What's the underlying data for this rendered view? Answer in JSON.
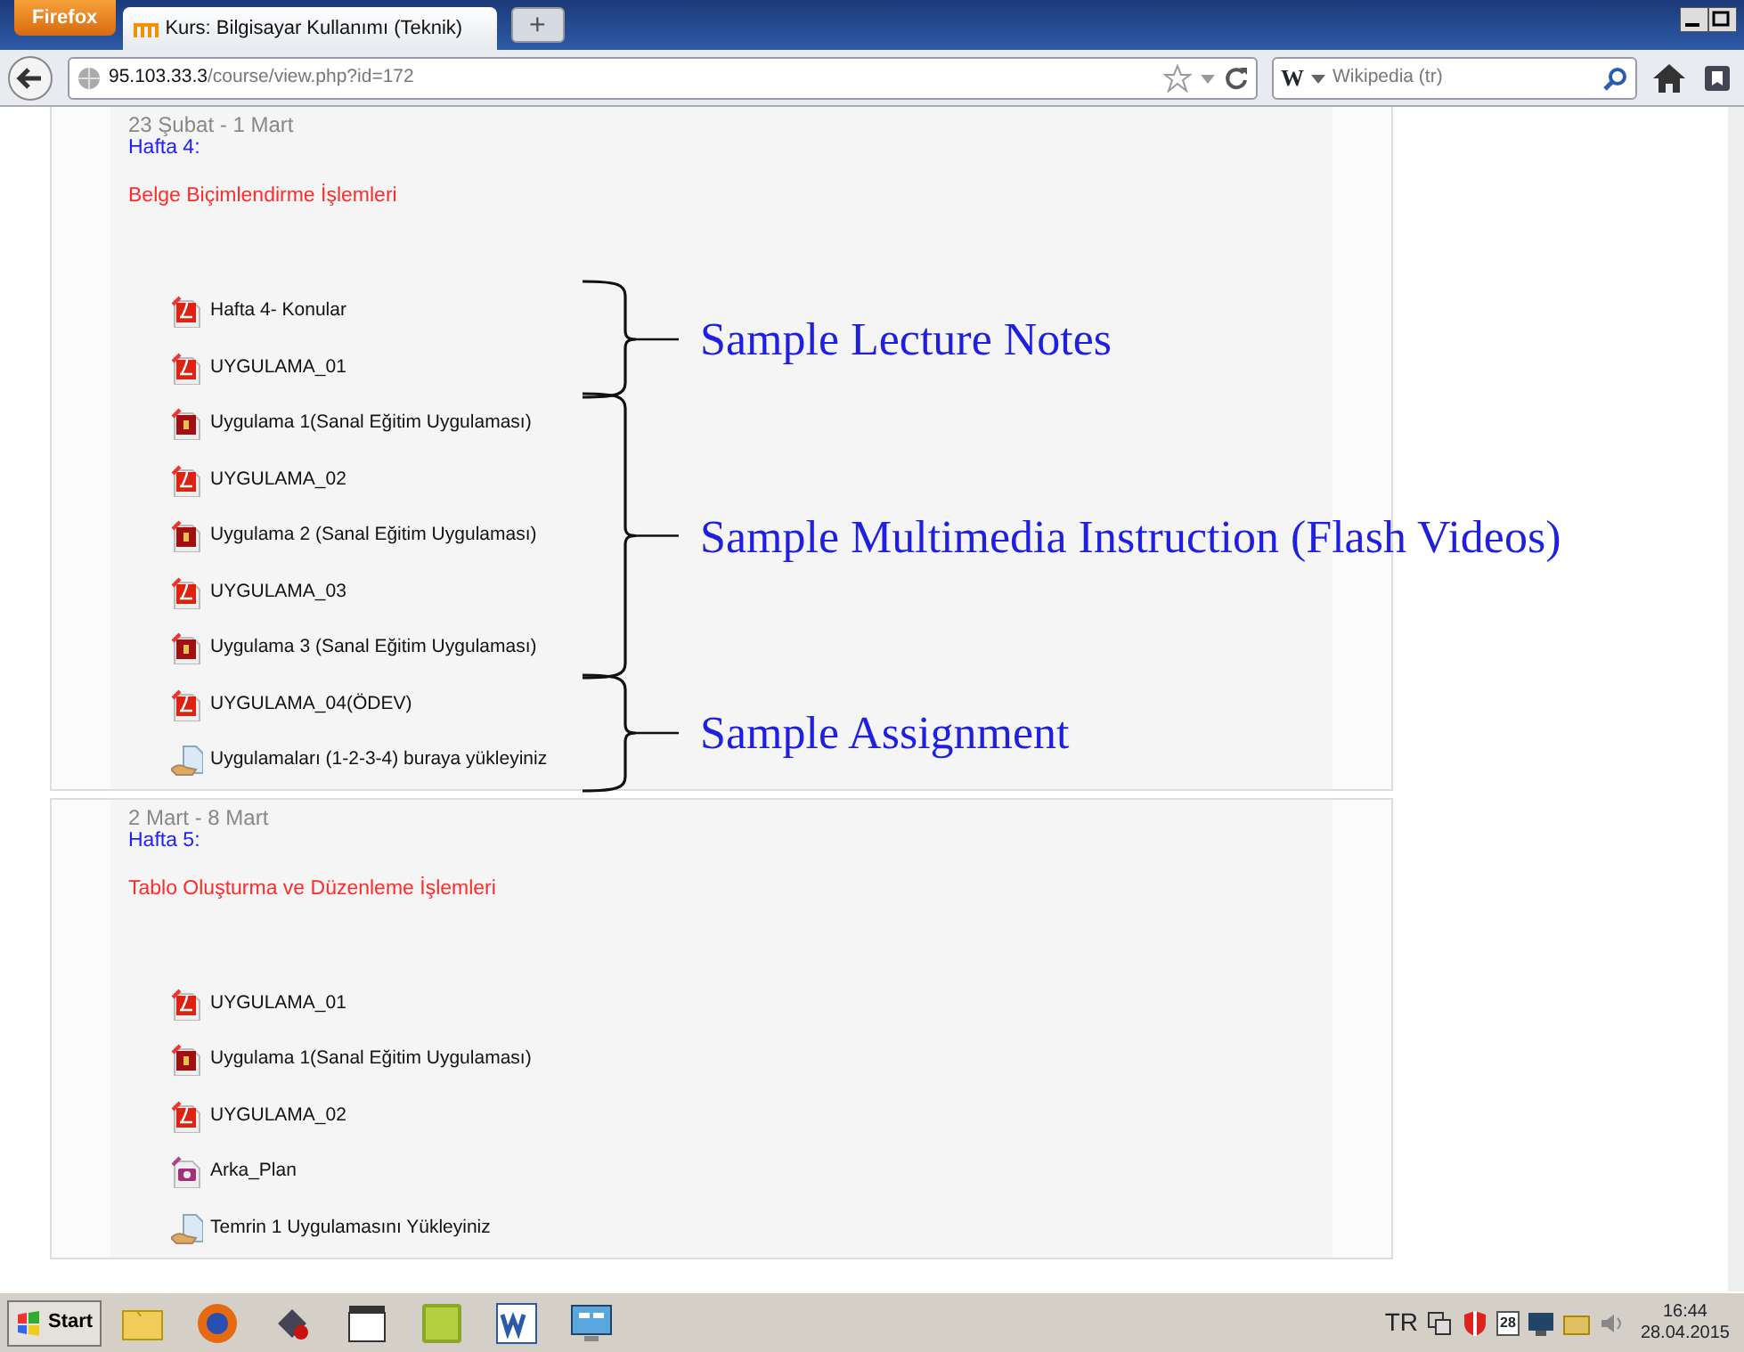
{
  "browser": {
    "menu_button": "Firefox",
    "tabs": [
      {
        "label": "Kurs: Bilgisayar Kullanımı (Teknik)",
        "selected": true
      }
    ],
    "new_tab": "+",
    "url_host": "95.103.33.3",
    "url_path": "/course/view.php?id=172",
    "search": {
      "engine": "W",
      "placeholder": "Wikipedia (tr)"
    }
  },
  "sections": [
    {
      "dates": "23 Şubat - 1 Mart",
      "week": "Hafta 4:",
      "topic": "Belge Biçimlendirme İşlemleri",
      "groups": [
        {
          "annotation": "Sample Lecture Notes",
          "items": [
            {
              "kind": "pdf",
              "label": "Hafta 4- Konular"
            },
            {
              "kind": "pdf",
              "label": "UYGULAMA_01"
            }
          ]
        },
        {
          "annotation": "Sample Multimedia Instruction (Flash Videos)",
          "items": [
            {
              "kind": "flash",
              "label": "Uygulama 1(Sanal Eğitim Uygulaması)"
            },
            {
              "kind": "pdf",
              "label": "UYGULAMA_02"
            },
            {
              "kind": "flash",
              "label": "Uygulama 2 (Sanal Eğitim Uygulaması)"
            },
            {
              "kind": "pdf",
              "label": "UYGULAMA_03"
            },
            {
              "kind": "flash",
              "label": "Uygulama 3 (Sanal Eğitim Uygulaması)"
            }
          ]
        },
        {
          "annotation": "Sample Assignment",
          "items": [
            {
              "kind": "pdf",
              "label": "UYGULAMA_04(ÖDEV)"
            },
            {
              "kind": "upload",
              "label": "Uygulamaları (1-2-3-4) buraya yükleyiniz"
            }
          ]
        }
      ]
    },
    {
      "dates": "2 Mart - 8 Mart",
      "week": "Hafta 5:",
      "topic": "Tablo Oluşturma ve Düzenleme İşlemleri",
      "items": [
        {
          "kind": "pdf",
          "label": "UYGULAMA_01"
        },
        {
          "kind": "flash",
          "label": "Uygulama 1(Sanal Eğitim Uygulaması)"
        },
        {
          "kind": "pdf",
          "label": "UYGULAMA_02"
        },
        {
          "kind": "image",
          "label": "Arka_Plan"
        },
        {
          "kind": "upload",
          "label": "Temrin 1 Uygulamasını Yükleyiniz"
        }
      ]
    }
  ],
  "taskbar": {
    "start": "Start",
    "language": "TR",
    "calendar_day": "28",
    "time": "16:44",
    "date": "28.04.2015"
  }
}
